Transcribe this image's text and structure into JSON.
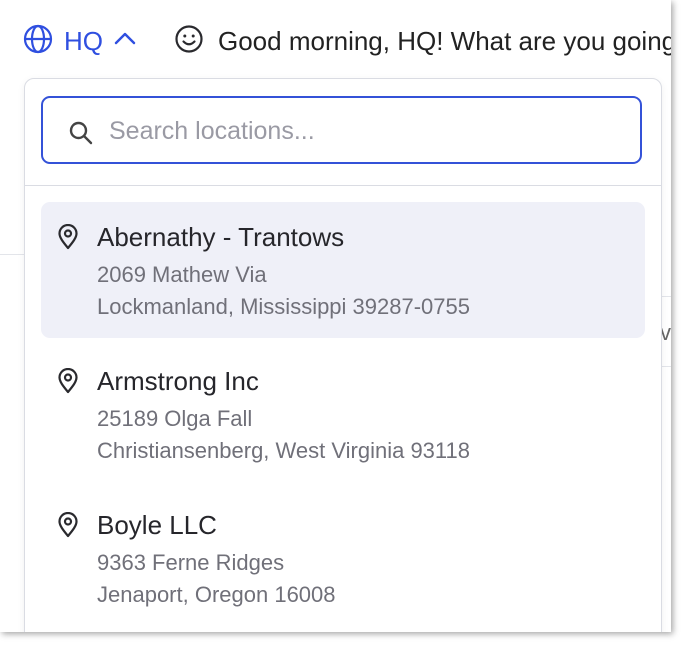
{
  "header": {
    "location_label": "HQ",
    "greeting": "Good morning, HQ! What are you going"
  },
  "search": {
    "placeholder": "Search locations...",
    "value": ""
  },
  "locations": [
    {
      "name": "Abernathy - Trantows",
      "address_line1": "2069 Mathew Via",
      "address_line2": "Lockmanland, Mississippi 39287-0755",
      "highlighted": true
    },
    {
      "name": "Armstrong Inc",
      "address_line1": "25189 Olga Fall",
      "address_line2": "Christiansenberg, West Virginia 93118",
      "highlighted": false
    },
    {
      "name": "Boyle LLC",
      "address_line1": "9363 Ferne Ridges",
      "address_line2": "Jenaport, Oregon 16008",
      "highlighted": false
    }
  ],
  "colors": {
    "accent": "#2f4fe0",
    "highlight_bg": "#eff0f8",
    "secondary_text": "#707079"
  },
  "icons": {
    "location_switch": "globe-icon",
    "location_toggle": "chevron-up-icon",
    "greeting": "smiley-icon",
    "search": "search-icon",
    "location_item": "map-pin-icon"
  }
}
